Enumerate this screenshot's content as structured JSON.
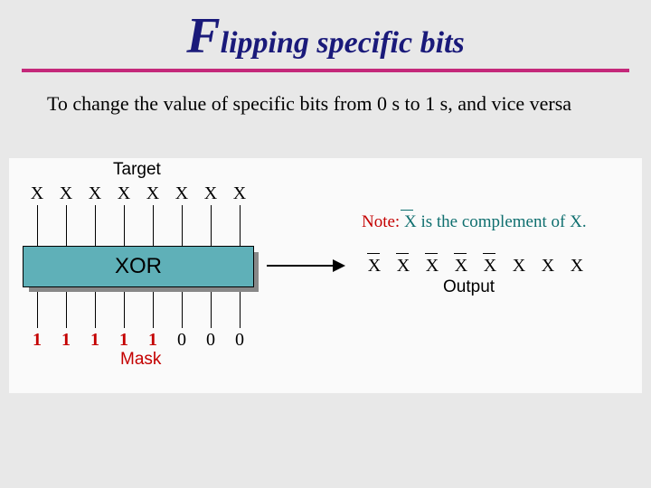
{
  "title": {
    "first_letter": "F",
    "rest": "lipping specific bits"
  },
  "body": "To change the value of specific bits from 0 s to 1 s, and vice versa",
  "diagram": {
    "target_label": "Target",
    "target_bits": [
      "X",
      "X",
      "X",
      "X",
      "X",
      "X",
      "X",
      "X"
    ],
    "op_label": "XOR",
    "mask_label": "Mask",
    "mask_bits": [
      "1",
      "1",
      "1",
      "1",
      "1",
      "0",
      "0",
      "0"
    ],
    "output_label": "Output",
    "output_bits": [
      {
        "v": "X",
        "bar": true
      },
      {
        "v": "X",
        "bar": true
      },
      {
        "v": "X",
        "bar": true
      },
      {
        "v": "X",
        "bar": true
      },
      {
        "v": "X",
        "bar": true
      },
      {
        "v": "X",
        "bar": false
      },
      {
        "v": "X",
        "bar": false
      },
      {
        "v": "X",
        "bar": false
      }
    ],
    "note": {
      "prefix": "Note:",
      "text_a": " X is the complement of ",
      "text_b": "X",
      "text_c": "."
    }
  }
}
